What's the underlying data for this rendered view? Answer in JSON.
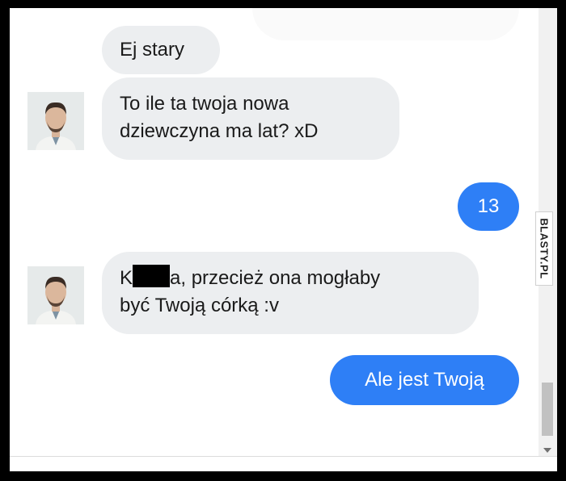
{
  "chat": {
    "messages": [
      {
        "from": "other",
        "text": "Ej stary"
      },
      {
        "from": "other",
        "line1": "To ile ta twoja nowa",
        "line2": "dziewczyna ma lat? xD"
      },
      {
        "from": "me",
        "text": "13"
      },
      {
        "from": "other",
        "line1_start": "K",
        "line1_end": "a, przecież ona mogłaby",
        "line2": "być Twoją córką :v"
      },
      {
        "from": "me",
        "text": "Ale jest Twoją"
      }
    ]
  },
  "watermark": {
    "text": "BLASTY.PL"
  },
  "colors": {
    "incoming_bubble": "#eceef0",
    "outgoing_bubble": "#2e7ff6",
    "background": "#ffffff"
  },
  "icons": {
    "avatar": "user-avatar-photo",
    "scroll_down": "chevron-down-icon"
  }
}
